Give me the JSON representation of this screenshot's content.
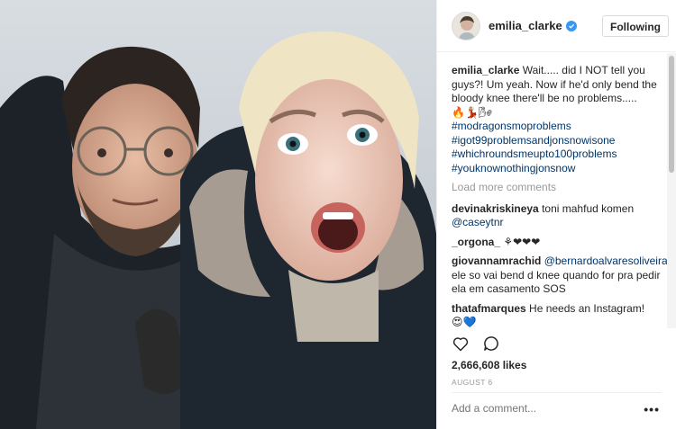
{
  "post": {
    "username": "emilia_clarke",
    "follow_label": "Following",
    "caption": {
      "username": "emilia_clarke",
      "text": "Wait..... did I NOT tell you guys?! Um yeah. Now if he'd only bend the bloody knee there'll be no problems.....",
      "emoji": "🔥💃🏼🌬",
      "hashtags": [
        "#modragonsmoproblems",
        "#igot99problemsandjonsnowisone",
        "#whichroundsmeupto100problems",
        "#youknownothingjonsnow"
      ]
    },
    "load_more_label": "Load more comments",
    "comments": [
      {
        "user": "devinakriskineya",
        "text": "toni mahfud komen",
        "mention": "@caseytnr"
      },
      {
        "user": "_orgona_",
        "text": "⚘❤❤❤"
      },
      {
        "user": "giovannamrachid",
        "mention": "@bernardoalvaresoliveira",
        "text": "ele so vai bend d knee quando for pra pedir ela em casamento SOS"
      },
      {
        "user": "thatafmarques",
        "text": "He needs an Instagram!",
        "emoji": "😍💙"
      }
    ],
    "likes": "2,666,608 likes",
    "date": "AUGUST 6",
    "add_comment_placeholder": "Add a comment...",
    "more_label": "•••"
  },
  "icons": {
    "like": "heart-icon",
    "comment": "comment-icon",
    "verified": "verified-badge-icon",
    "more": "more-options-icon"
  },
  "colors": {
    "verified": "#3897f0",
    "hashtag": "#003569",
    "muted": "#999999"
  }
}
